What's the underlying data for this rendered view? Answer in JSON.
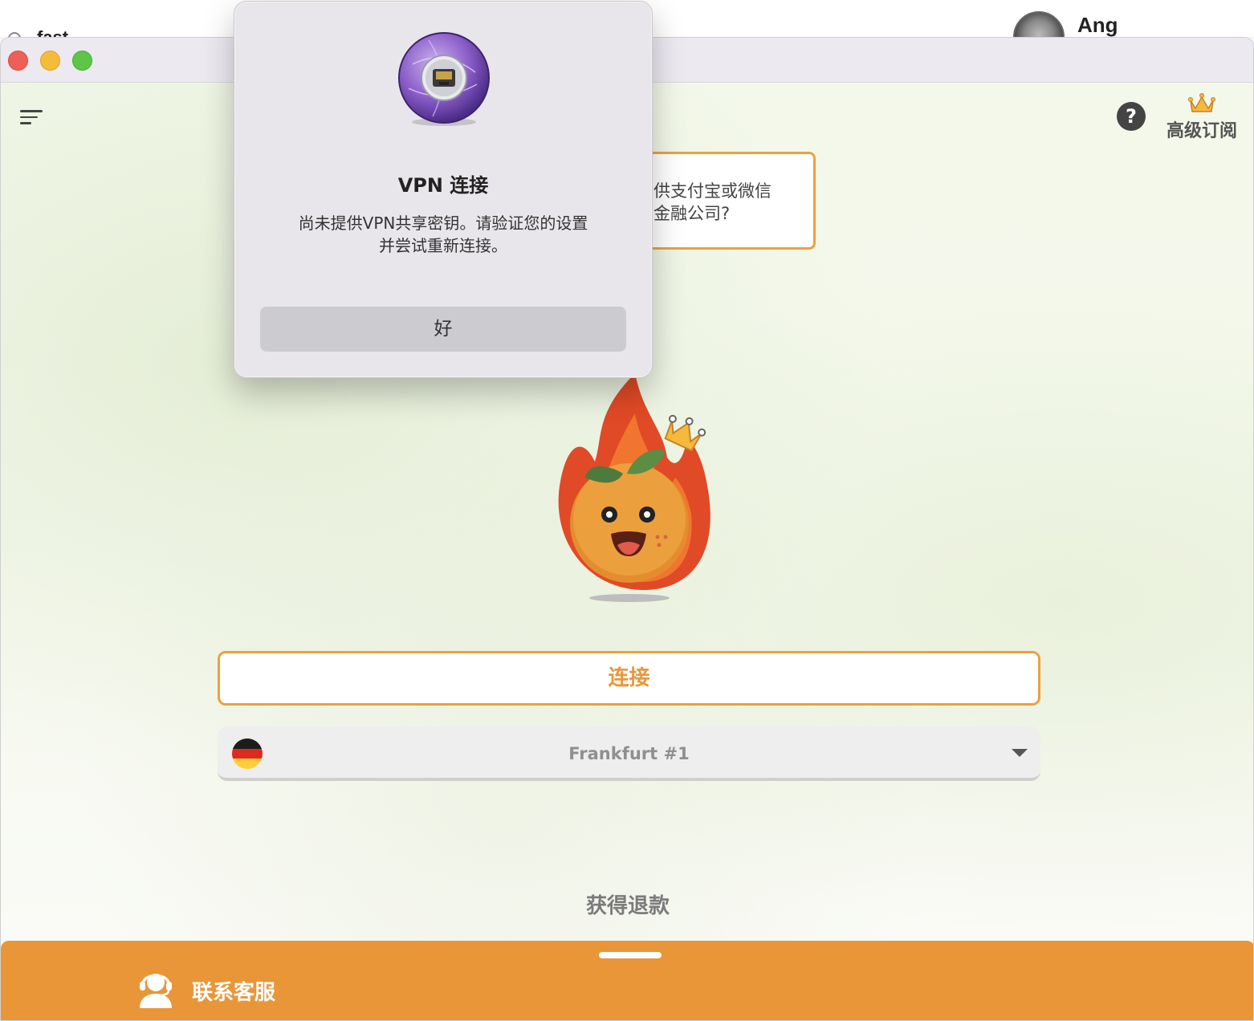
{
  "background_app": {
    "search_text": "fast",
    "user_name": "Ang"
  },
  "window": {
    "traffic_lights": [
      "close",
      "minimize",
      "zoom"
    ]
  },
  "toolbar": {
    "menu_icon": "hamburger-menu-icon",
    "help_icon": "question-mark-icon",
    "help_glyph": "?",
    "premium_label": "高级订阅",
    "premium_icon": "crown-icon"
  },
  "tip": {
    "line1": "供支付宝或微信",
    "line2": "金融公司?"
  },
  "mascot": {
    "description_icon": "flaming-orange-mascot-icon"
  },
  "connect": {
    "label": "连接"
  },
  "server": {
    "name": "Frankfurt #1",
    "flag": "germany-flag-icon",
    "flag_colors": [
      "#000000",
      "#dd0000",
      "#ffce00"
    ]
  },
  "refund": {
    "label": "获得退款"
  },
  "bottom_bar": {
    "support_label": "联系客服",
    "support_icon": "headset-agent-icon"
  },
  "dialog": {
    "title": "VPN 连接",
    "message_line1": "尚未提供VPN共享密钥。请验证您的设置",
    "message_line2": "并尝试重新连接。",
    "ok_label": "好",
    "icon": "network-port-icon"
  },
  "colors": {
    "accent": "#e99638",
    "accent_border": "#eba23f",
    "background": "#f4f7ee"
  }
}
